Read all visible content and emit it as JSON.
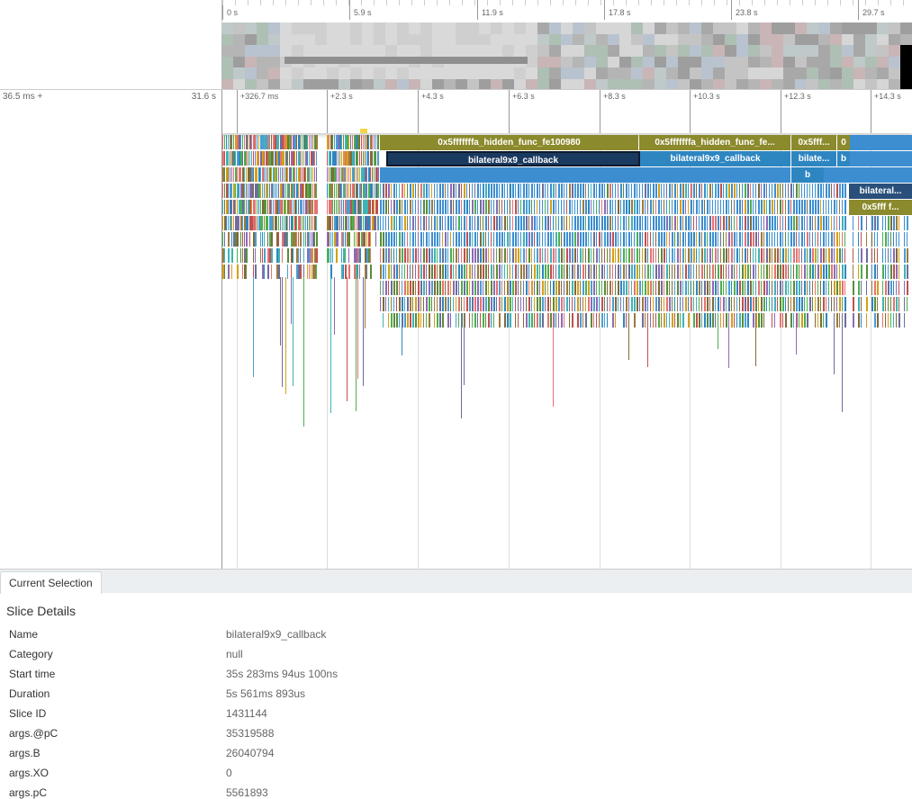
{
  "overview": {
    "ticks": [
      "0 s",
      "5.9 s",
      "11.9 s",
      "17.8 s",
      "23.8 s",
      "29.7 s"
    ]
  },
  "timeline": {
    "left_label": "36.5 ms +",
    "right_label": "31.6 s",
    "ticks": [
      "+326.7 ms",
      "+2.3 s",
      "+4.3 s",
      "+6.3 s",
      "+8.3 s",
      "+10.3 s",
      "+12.3 s",
      "+14.3 s"
    ]
  },
  "flame": {
    "slices": {
      "hidden_func_1": "0x5fffffffa_hidden_func_fe100980",
      "hidden_func_2": "0x5fffffffa_hidden_func_fe...",
      "hidden_func_3": "0x5fff...",
      "hidden_func_4": "0",
      "callback_1": "bilateral9x9_callback",
      "callback_2": "bilateral9x9_callback",
      "callback_3": "bilate...",
      "callback_4": "b",
      "callback_5": "b",
      "callback_6": "bilateral...",
      "hidden_func_5": "0x5fff f..."
    },
    "colors": {
      "olive": "#8b8a2c",
      "blue": "#2e86c1",
      "navy_selected": "#1b3a60"
    }
  },
  "details": {
    "tab_label": "Current Selection",
    "section_title": "Slice Details",
    "rows": [
      {
        "key": "Name",
        "value": "bilateral9x9_callback"
      },
      {
        "key": "Category",
        "value": "null"
      },
      {
        "key": "Start time",
        "value": "35s 283ms 94us 100ns"
      },
      {
        "key": "Duration",
        "value": "5s 561ms 893us"
      },
      {
        "key": "Slice ID",
        "value": "1431144"
      },
      {
        "key": "args.@pC",
        "value": "35319588"
      },
      {
        "key": "args.B",
        "value": "26040794"
      },
      {
        "key": "args.XO",
        "value": "0"
      },
      {
        "key": "args.pC",
        "value": "5561893"
      }
    ]
  }
}
